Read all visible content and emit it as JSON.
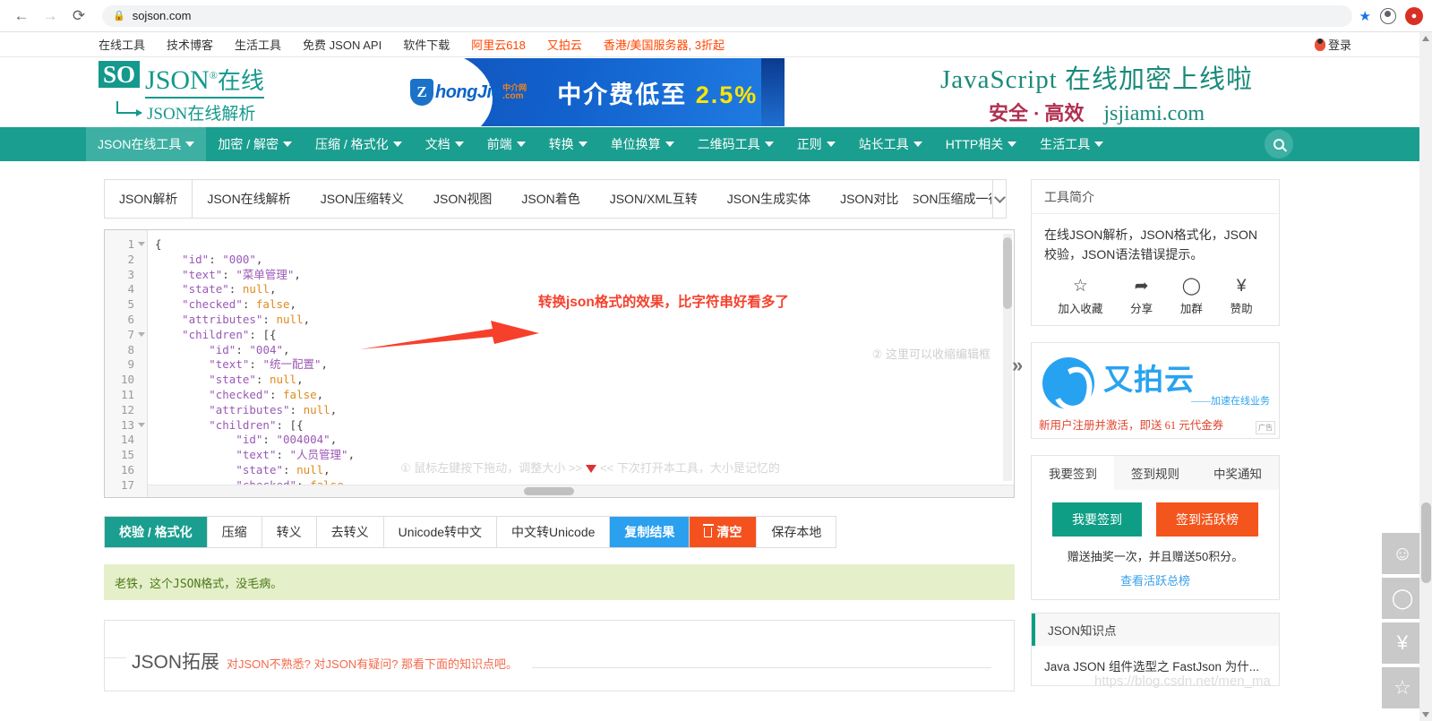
{
  "browser": {
    "back_icon": "back-arrow",
    "forward_icon": "forward-arrow",
    "reload_icon": "reload",
    "url": "sojson.com",
    "lock_icon": "lock",
    "star_icon": "star",
    "profile_icon": "profile"
  },
  "toplinks": [
    {
      "label": "在线工具",
      "hot": false
    },
    {
      "label": "技术博客",
      "hot": false
    },
    {
      "label": "生活工具",
      "hot": false
    },
    {
      "label": "免费 JSON API",
      "hot": false
    },
    {
      "label": "软件下载",
      "hot": false
    },
    {
      "label": "阿里云618",
      "hot": true
    },
    {
      "label": "又拍云",
      "hot": true
    },
    {
      "label": "香港/美国服务器, 3折起",
      "hot": true
    }
  ],
  "login": {
    "label": "登录"
  },
  "logo": {
    "so": "SO",
    "json": "JSON",
    "reg": "®",
    "zaixian": "在线",
    "tagline": "JSON在线解析"
  },
  "ads": {
    "banner1": {
      "brand_z": "Z",
      "brand_name": "hongJie",
      "brand_cn": "中介网",
      "brand_com": ".com",
      "text": "中介费低至",
      "pct": "2.5%"
    },
    "banner2": {
      "line1": "JavaScript 在线加密上线啦",
      "safe": "安全 · 高效",
      "url": "jsjiami.com"
    }
  },
  "nav": {
    "items": [
      {
        "label": "JSON在线工具",
        "active": true
      },
      {
        "label": "加密 / 解密",
        "active": false
      },
      {
        "label": "压缩 / 格式化",
        "active": false
      },
      {
        "label": "文档",
        "active": false
      },
      {
        "label": "前端",
        "active": false
      },
      {
        "label": "转换",
        "active": false
      },
      {
        "label": "单位换算",
        "active": false
      },
      {
        "label": "二维码工具",
        "active": false
      },
      {
        "label": "正则",
        "active": false
      },
      {
        "label": "站长工具",
        "active": false
      },
      {
        "label": "HTTP相关",
        "active": false
      },
      {
        "label": "生活工具",
        "active": false
      }
    ],
    "search_icon": "search-icon"
  },
  "tabs": [
    {
      "label": "JSON解析",
      "active": true
    },
    {
      "label": "JSON在线解析",
      "active": false
    },
    {
      "label": "JSON压缩转义",
      "active": false
    },
    {
      "label": "JSON视图",
      "active": false
    },
    {
      "label": "JSON着色",
      "active": false
    },
    {
      "label": "JSON/XML互转",
      "active": false
    },
    {
      "label": "JSON生成实体",
      "active": false
    },
    {
      "label": "JSON对比",
      "active": false
    },
    {
      "label": "JSON压缩成一行",
      "active": false
    }
  ],
  "editor": {
    "line_numbers": [
      "1",
      "2",
      "3",
      "4",
      "5",
      "6",
      "7",
      "8",
      "9",
      "10",
      "11",
      "12",
      "13",
      "14",
      "15",
      "16",
      "17"
    ],
    "fold_lines": [
      "1",
      "7",
      "13"
    ],
    "lines": [
      {
        "indent": 0,
        "raw": "{"
      },
      {
        "indent": 1,
        "key": "\"id\"",
        "value": "\"000\"",
        "type": "str",
        "comma": true
      },
      {
        "indent": 1,
        "key": "\"text\"",
        "value": "\"菜单管理\"",
        "type": "str",
        "comma": true
      },
      {
        "indent": 1,
        "key": "\"state\"",
        "value": "null",
        "type": "null",
        "comma": true
      },
      {
        "indent": 1,
        "key": "\"checked\"",
        "value": "false",
        "type": "bool",
        "comma": true
      },
      {
        "indent": 1,
        "key": "\"attributes\"",
        "value": "null",
        "type": "null",
        "comma": true
      },
      {
        "indent": 1,
        "key": "\"children\"",
        "value": "[{",
        "type": "punc",
        "comma": false
      },
      {
        "indent": 2,
        "key": "\"id\"",
        "value": "\"004\"",
        "type": "str",
        "comma": true
      },
      {
        "indent": 2,
        "key": "\"text\"",
        "value": "\"统一配置\"",
        "type": "str",
        "comma": true
      },
      {
        "indent": 2,
        "key": "\"state\"",
        "value": "null",
        "type": "null",
        "comma": true
      },
      {
        "indent": 2,
        "key": "\"checked\"",
        "value": "false",
        "type": "bool",
        "comma": true
      },
      {
        "indent": 2,
        "key": "\"attributes\"",
        "value": "null",
        "type": "null",
        "comma": true
      },
      {
        "indent": 2,
        "key": "\"children\"",
        "value": "[{",
        "type": "punc",
        "comma": false
      },
      {
        "indent": 3,
        "key": "\"id\"",
        "value": "\"004004\"",
        "type": "str",
        "comma": true
      },
      {
        "indent": 3,
        "key": "\"text\"",
        "value": "\"人员管理\"",
        "type": "str",
        "comma": true
      },
      {
        "indent": 3,
        "key": "\"state\"",
        "value": "null",
        "type": "null",
        "comma": true
      },
      {
        "indent": 3,
        "key": "\"checked\"",
        "value": "false",
        "type": "bool",
        "comma": true
      }
    ],
    "hint_right": "② 这里可以收缩编辑框",
    "hint_bottom_1": "① 鼠标左键按下拖动，调整大小 >>",
    "hint_bottom_2": "<< 下次打开本工具，大小是记忆的"
  },
  "annotation": {
    "text": "转换json格式的效果，比字符串好看多了",
    "color": "#f6402c"
  },
  "expander": {
    "label": "»"
  },
  "buttons": [
    {
      "label": "校验 / 格式化",
      "style": "green"
    },
    {
      "label": "压缩",
      "style": "plain"
    },
    {
      "label": "转义",
      "style": "plain"
    },
    {
      "label": "去转义",
      "style": "plain"
    },
    {
      "label": "Unicode转中文",
      "style": "plain"
    },
    {
      "label": "中文转Unicode",
      "style": "plain"
    },
    {
      "label": "复制结果",
      "style": "blue"
    },
    {
      "label": "清空",
      "style": "orange",
      "icon": "trash-icon"
    },
    {
      "label": "保存本地",
      "style": "plain"
    }
  ],
  "result_message": "老铁，这个JSON格式，没毛病。",
  "extend": {
    "title": "JSON拓展",
    "subtitle": "对JSON不熟悉? 对JSON有疑问? 那看下面的知识点吧。"
  },
  "sidebar": {
    "intro_card": {
      "title": "工具简介",
      "body": "在线JSON解析，JSON格式化，JSON校验，JSON语法错误提示。",
      "actions": [
        {
          "icon": "star-outline-icon",
          "glyph": "☆",
          "label": "加入收藏"
        },
        {
          "icon": "share-icon",
          "glyph": "➦",
          "label": "分享"
        },
        {
          "icon": "qq-group-icon",
          "glyph": "◯",
          "label": "加群"
        },
        {
          "icon": "yen-icon",
          "glyph": "¥",
          "label": "赞助"
        }
      ]
    },
    "upyun_ad": {
      "name": "又拍云",
      "slogan": "——加速在线业务",
      "promo": "新用户注册并激活，即送 61 元代金券",
      "badge": "广告"
    },
    "sign_card": {
      "tabs": [
        {
          "label": "我要签到",
          "active": true
        },
        {
          "label": "签到规则",
          "active": false
        },
        {
          "label": "中奖通知",
          "active": false
        }
      ],
      "btn_primary": "我要签到",
      "btn_secondary": "签到活跃榜",
      "note": "赠送抽奖一次，并且赠送50积分。",
      "link": "查看活跃总榜"
    },
    "knowledge_card": {
      "title": "JSON知识点",
      "items": [
        "Java JSON 组件选型之 FastJson 为什..."
      ]
    }
  },
  "right_toolbar": [
    {
      "icon": "smiley-icon",
      "glyph": "☺"
    },
    {
      "icon": "qq-icon",
      "glyph": "◯"
    },
    {
      "icon": "yen-icon",
      "glyph": "¥"
    },
    {
      "icon": "star-icon",
      "glyph": "☆"
    }
  ],
  "watermark": "https://blog.csdn.net/men_ma"
}
